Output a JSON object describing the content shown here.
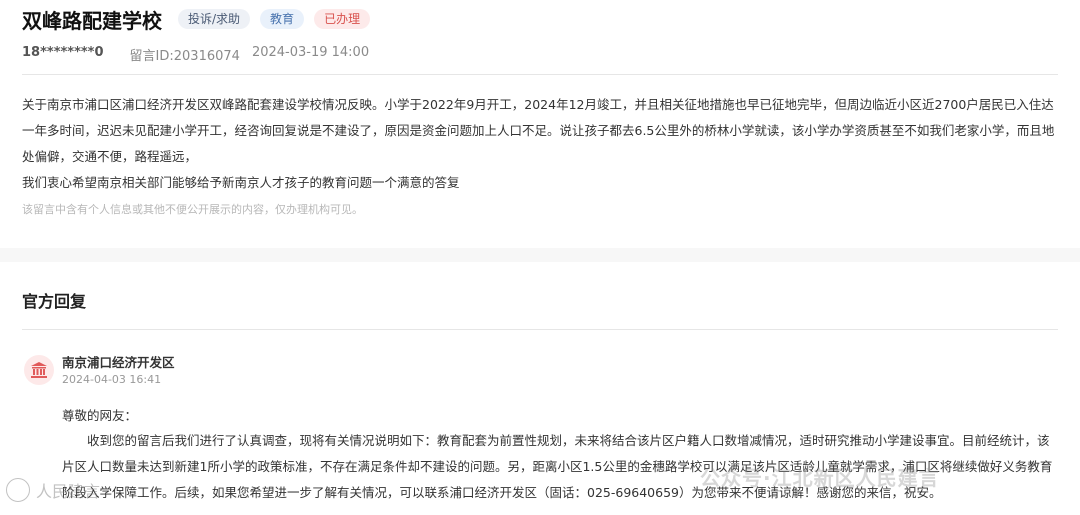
{
  "header": {
    "title": "双峰路配建学校",
    "tags": [
      "投诉/求助",
      "教育",
      "已办理"
    ]
  },
  "meta": {
    "phone": "18********0",
    "message_id": "留言ID:20316074",
    "date": "2024-03-19 14:00"
  },
  "message": {
    "paragraph1": "关于南京市浦口区浦口经济开发区双峰路配套建设学校情况反映。小学于2022年9月开工，2024年12月竣工，并且相关征地措施也早已征地完毕，但周边临近小区近2700户居民已入住达一年多时间，迟迟未见配建小学开工，经咨询回复说是不建设了，原因是资金问题加上人口不足。说让孩子都去6.5公里外的桥林小学就读，该小学办学资质甚至不如我们老家小学，而且地处偏僻，交通不便，路程遥远，",
    "paragraph2": "我们衷心希望南京相关部门能够给予新南京人才孩子的教育问题一个满意的答复",
    "notice": "该留言中含有个人信息或其他不便公开展示的内容，仅办理机构可见。"
  },
  "official": {
    "section_title": "官方回复",
    "org_name": "南京浦口经济开发区",
    "reply_date": "2024-04-03 16:41",
    "greeting": "尊敬的网友：",
    "body": "收到您的留言后我们进行了认真调查，现将有关情况说明如下：教育配套为前置性规划，未来将结合该片区户籍人口数增减情况，适时研究推动小学建设事宜。目前经统计，该片区人口数量未达到新建1所小学的政策标准，不存在满足条件却不建设的问题。另，距离小区1.5公里的金穗路学校可以满足该片区适龄儿童就学需求，浦口区将继续做好义务教育阶段入学保障工作。后续，如果您希望进一步了解有关情况，可以联系浦口经济开发区（固话：025-69640659）为您带来不便请谅解！感谢您的来信，祝安。"
  },
  "watermarks": {
    "right": "公众号·江北新区人民建言",
    "left": "人民建言"
  },
  "colors": {
    "tag_red": "#d9534f",
    "tag_blue": "#4873ae",
    "avatar_bg": "#fde9e9"
  }
}
